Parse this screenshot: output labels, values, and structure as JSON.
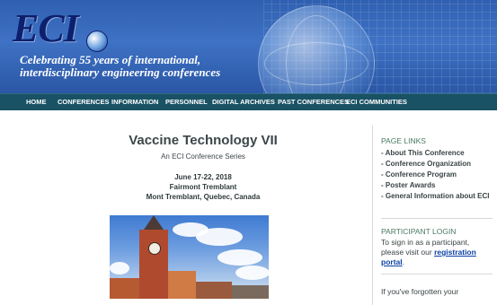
{
  "header": {
    "logo_text": "ECI",
    "tagline_line1": "Celebrating 55 years of international,",
    "tagline_line2": "interdisciplinary engineering conferences"
  },
  "nav": {
    "items": [
      {
        "label": "HOME"
      },
      {
        "label": "CONFERENCES"
      },
      {
        "label": "INFORMATION"
      },
      {
        "label": "PERSONNEL"
      },
      {
        "label": "DIGITAL ARCHIVES"
      },
      {
        "label": "PAST CONFERENCES"
      },
      {
        "label": "ECI COMMUNITIES"
      }
    ]
  },
  "main": {
    "title": "Vaccine Technology VII",
    "series": "An ECI Conference Series",
    "dates": "June 17-22, 2018",
    "venue": "Fairmont Tremblant",
    "location": "Mont Tremblant, Quebec, Canada"
  },
  "sidebar": {
    "page_links_heading": "PAGE LINKS",
    "links": [
      {
        "label": "- About This Conference"
      },
      {
        "label": "- Conference Organization"
      },
      {
        "label": "- Conference Program"
      },
      {
        "label": "- Poster Awards"
      },
      {
        "label": "- General Information about ECI"
      }
    ],
    "login_heading": "PARTICIPANT LOGIN",
    "login_text_before": "To sign in as a participant, please visit our ",
    "login_link": "registration portal",
    "login_text_after": ".",
    "forgot_text": "If you've forgotten your"
  },
  "colors": {
    "header_blue": "#3f72c4",
    "nav_bg": "#1a5265",
    "link_blue": "#0b3fa6",
    "heading_green": "#4a7a62"
  }
}
